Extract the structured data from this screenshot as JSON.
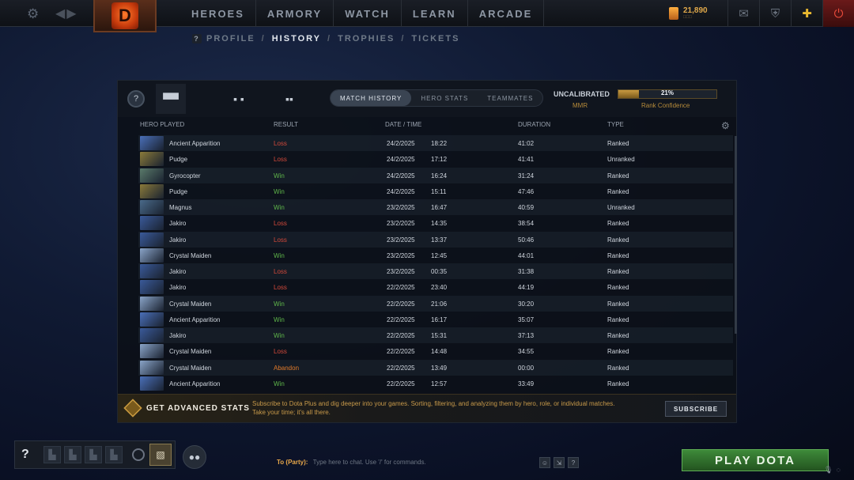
{
  "topbar": {
    "nav": [
      "HEROES",
      "ARMORY",
      "WATCH",
      "LEARN",
      "ARCADE"
    ],
    "gold": "21,890",
    "gold_sub": "□□□",
    "logo_letter": "D",
    "settings_icon": "⚙",
    "nav_arrows": "◀▶",
    "icons": [
      {
        "name": "mail-icon",
        "glyph": "✉"
      },
      {
        "name": "shield-banner-icon",
        "glyph": "⛨"
      },
      {
        "name": "plus-icon",
        "glyph": "✚"
      },
      {
        "name": "power-icon",
        "glyph": "⏻"
      }
    ]
  },
  "subnav": {
    "help": "?",
    "tabs": [
      "PROFILE",
      "HISTORY",
      "TROPHIES",
      "TICKETS"
    ],
    "active": "HISTORY",
    "sep": "/"
  },
  "panel": {
    "help": "?",
    "segments": [
      "MATCH HISTORY",
      "HERO STATS",
      "TEAMMATES"
    ],
    "active_segment": "MATCH HISTORY",
    "rank": {
      "label": "UNCALIBRATED",
      "mmr": "MMR",
      "percent": "21%",
      "fill": 0.21,
      "confidence_label": "Rank Confidence"
    },
    "columns": [
      "HERO PLAYED",
      "RESULT",
      "DATE / TIME",
      "DURATION",
      "TYPE"
    ],
    "matches": [
      {
        "hero": "Ancient Apparition",
        "result": "Loss",
        "date": "24/2/2025",
        "time": "18:22",
        "duration": "41:02",
        "type": "Ranked"
      },
      {
        "hero": "Pudge",
        "result": "Loss",
        "date": "24/2/2025",
        "time": "17:12",
        "duration": "41:41",
        "type": "Unranked"
      },
      {
        "hero": "Gyrocopter",
        "result": "Win",
        "date": "24/2/2025",
        "time": "16:24",
        "duration": "31:24",
        "type": "Ranked"
      },
      {
        "hero": "Pudge",
        "result": "Win",
        "date": "24/2/2025",
        "time": "15:11",
        "duration": "47:46",
        "type": "Ranked"
      },
      {
        "hero": "Magnus",
        "result": "Win",
        "date": "23/2/2025",
        "time": "16:47",
        "duration": "40:59",
        "type": "Unranked"
      },
      {
        "hero": "Jakiro",
        "result": "Loss",
        "date": "23/2/2025",
        "time": "14:35",
        "duration": "38:54",
        "type": "Ranked"
      },
      {
        "hero": "Jakiro",
        "result": "Loss",
        "date": "23/2/2025",
        "time": "13:37",
        "duration": "50:46",
        "type": "Ranked"
      },
      {
        "hero": "Crystal Maiden",
        "result": "Win",
        "date": "23/2/2025",
        "time": "12:45",
        "duration": "44:01",
        "type": "Ranked"
      },
      {
        "hero": "Jakiro",
        "result": "Loss",
        "date": "23/2/2025",
        "time": "00:35",
        "duration": "31:38",
        "type": "Ranked"
      },
      {
        "hero": "Jakiro",
        "result": "Loss",
        "date": "22/2/2025",
        "time": "23:40",
        "duration": "44:19",
        "type": "Ranked"
      },
      {
        "hero": "Crystal Maiden",
        "result": "Win",
        "date": "22/2/2025",
        "time": "21:06",
        "duration": "30:20",
        "type": "Ranked"
      },
      {
        "hero": "Ancient Apparition",
        "result": "Win",
        "date": "22/2/2025",
        "time": "16:17",
        "duration": "35:07",
        "type": "Ranked"
      },
      {
        "hero": "Jakiro",
        "result": "Win",
        "date": "22/2/2025",
        "time": "15:31",
        "duration": "37:13",
        "type": "Ranked"
      },
      {
        "hero": "Crystal Maiden",
        "result": "Loss",
        "date": "22/2/2025",
        "time": "14:48",
        "duration": "34:55",
        "type": "Ranked"
      },
      {
        "hero": "Crystal Maiden",
        "result": "Abandon",
        "date": "22/2/2025",
        "time": "13:49",
        "duration": "00:00",
        "type": "Ranked"
      },
      {
        "hero": "Ancient Apparition",
        "result": "Win",
        "date": "22/2/2025",
        "time": "12:57",
        "duration": "33:49",
        "type": "Ranked"
      }
    ],
    "hero_colors": {
      "Ancient Apparition": "#4a6fb8",
      "Pudge": "#8a7a3a",
      "Gyrocopter": "#5a7a6a",
      "Magnus": "#4a6a8a",
      "Jakiro": "#3a5a9a",
      "Crystal Maiden": "#8aa4c8"
    }
  },
  "promo": {
    "title": "GET ADVANCED STATS",
    "text": "Subscribe to Dota Plus and dig deeper into your games. Sorting, filtering, and analyzing them by hero, role, or individual matches. Take your time; it's all there.",
    "button": "SUBSCRIBE"
  },
  "party": {
    "help": "?"
  },
  "chat": {
    "to": "To (Party):",
    "placeholder": "Type here to chat. Use '/' for commands."
  },
  "play_button": "PLAY DOTA"
}
